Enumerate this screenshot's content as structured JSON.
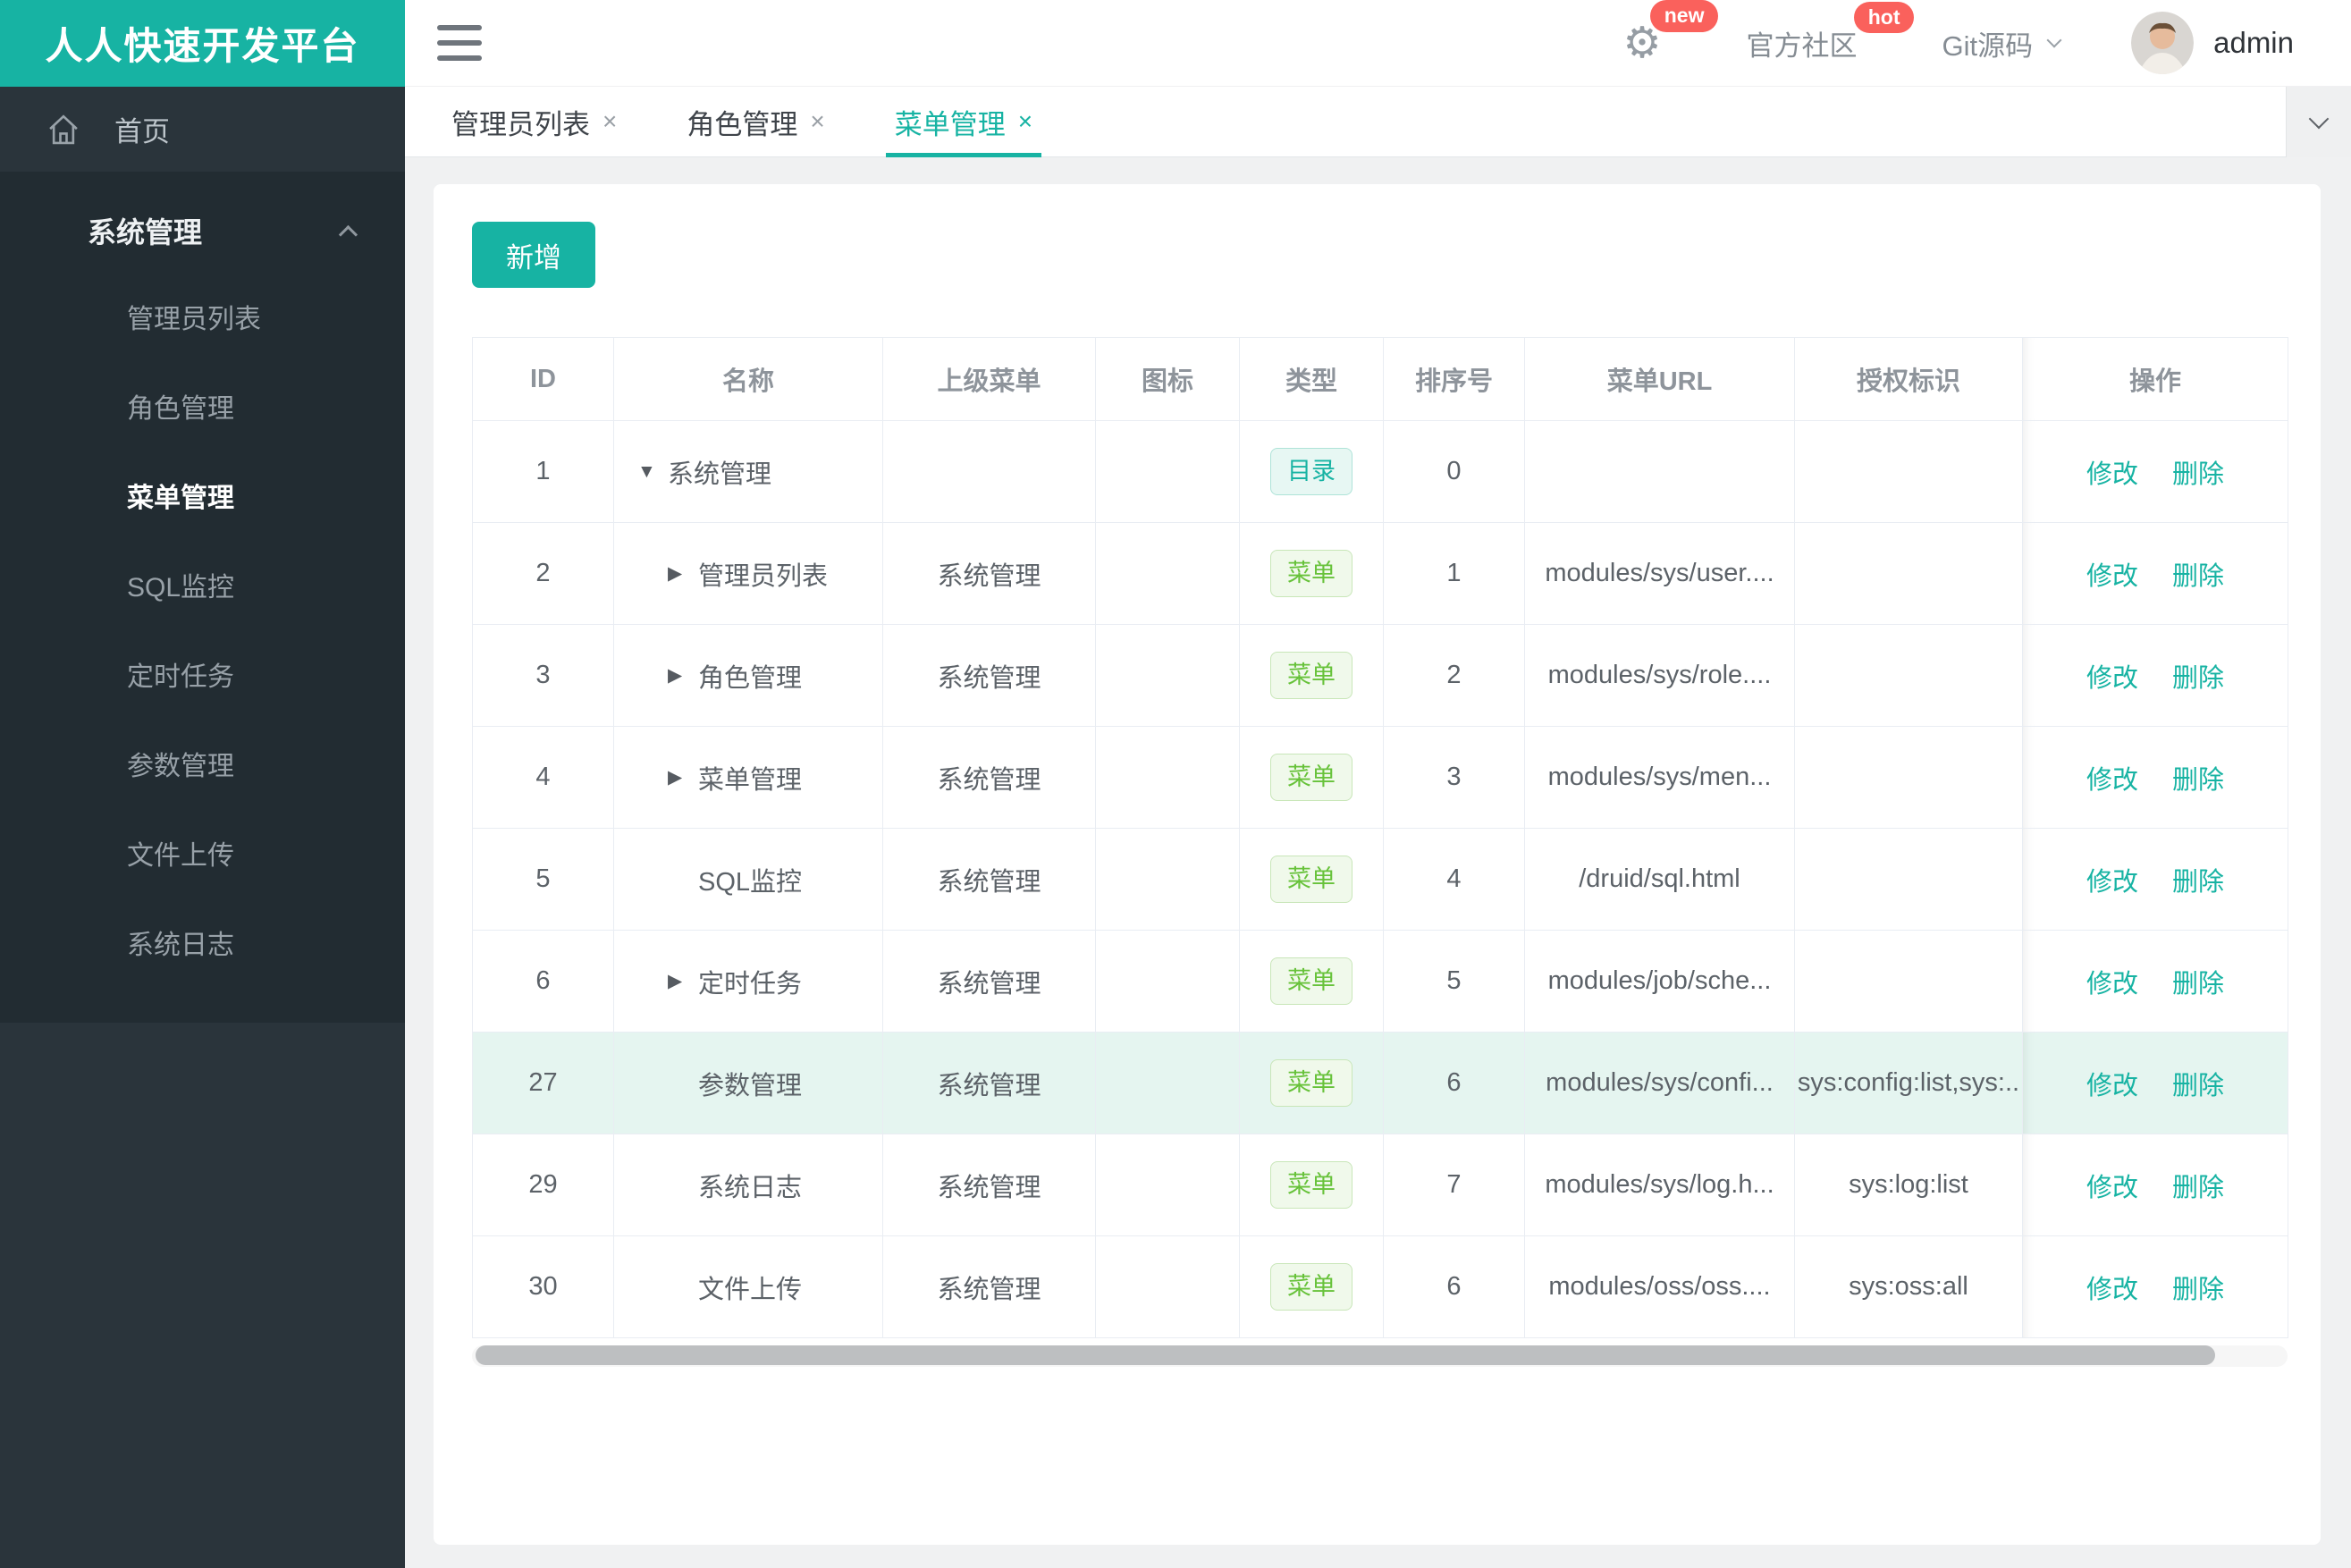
{
  "app": {
    "title": "人人快速开发平台"
  },
  "topbar": {
    "badge_new": "new",
    "community_label": "官方社区",
    "badge_hot": "hot",
    "git_label": "Git源码",
    "username": "admin"
  },
  "sidebar": {
    "home_label": "首页",
    "group_label": "系统管理",
    "items": [
      {
        "label": "管理员列表"
      },
      {
        "label": "角色管理"
      },
      {
        "label": "菜单管理",
        "active": true
      },
      {
        "label": "SQL监控"
      },
      {
        "label": "定时任务"
      },
      {
        "label": "参数管理"
      },
      {
        "label": "文件上传"
      },
      {
        "label": "系统日志"
      }
    ]
  },
  "tabs": [
    {
      "label": "管理员列表"
    },
    {
      "label": "角色管理"
    },
    {
      "label": "菜单管理",
      "active": true
    }
  ],
  "toolbar": {
    "add_label": "新增"
  },
  "icons": {
    "caret_down": "▼",
    "caret_right": "▶",
    "close": "×"
  },
  "table": {
    "columns": [
      "ID",
      "名称",
      "上级菜单",
      "图标",
      "类型",
      "排序号",
      "菜单URL",
      "授权标识",
      "操作"
    ],
    "type_badges": {
      "dir": "目录",
      "menu": "菜单"
    },
    "actions": {
      "edit": "修改",
      "delete": "删除"
    },
    "rows": [
      {
        "id": "1",
        "name": "系统管理",
        "caret": "down",
        "parent": "",
        "type": "dir",
        "order": "0",
        "url": "",
        "perms": "",
        "highlight": false
      },
      {
        "id": "2",
        "name": "管理员列表",
        "caret": "right",
        "parent": "系统管理",
        "type": "menu",
        "order": "1",
        "url": "modules/sys/user....",
        "perms": "",
        "highlight": false
      },
      {
        "id": "3",
        "name": "角色管理",
        "caret": "right",
        "parent": "系统管理",
        "type": "menu",
        "order": "2",
        "url": "modules/sys/role....",
        "perms": "",
        "highlight": false
      },
      {
        "id": "4",
        "name": "菜单管理",
        "caret": "right",
        "parent": "系统管理",
        "type": "menu",
        "order": "3",
        "url": "modules/sys/men...",
        "perms": "",
        "highlight": false
      },
      {
        "id": "5",
        "name": "SQL监控",
        "caret": "none",
        "parent": "系统管理",
        "type": "menu",
        "order": "4",
        "url": "/druid/sql.html",
        "perms": "",
        "highlight": false
      },
      {
        "id": "6",
        "name": "定时任务",
        "caret": "right",
        "parent": "系统管理",
        "type": "menu",
        "order": "5",
        "url": "modules/job/sche...",
        "perms": "",
        "highlight": false
      },
      {
        "id": "27",
        "name": "参数管理",
        "caret": "none",
        "parent": "系统管理",
        "type": "menu",
        "order": "6",
        "url": "modules/sys/confi...",
        "perms": "sys:config:list,sys:..",
        "highlight": true
      },
      {
        "id": "29",
        "name": "系统日志",
        "caret": "none",
        "parent": "系统管理",
        "type": "menu",
        "order": "7",
        "url": "modules/sys/log.h...",
        "perms": "sys:log:list",
        "highlight": false
      },
      {
        "id": "30",
        "name": "文件上传",
        "caret": "none",
        "parent": "系统管理",
        "type": "menu",
        "order": "6",
        "url": "modules/oss/oss....",
        "perms": "sys:oss:all",
        "highlight": false
      }
    ]
  },
  "colors": {
    "accent": "#17b3a3",
    "badge_red": "#fa615c",
    "tag_menu_green": "#67c23a",
    "row_highlight": "#e5f5f0",
    "sidebar_bg": "#2a343b",
    "submenu_bg": "#222c32"
  }
}
